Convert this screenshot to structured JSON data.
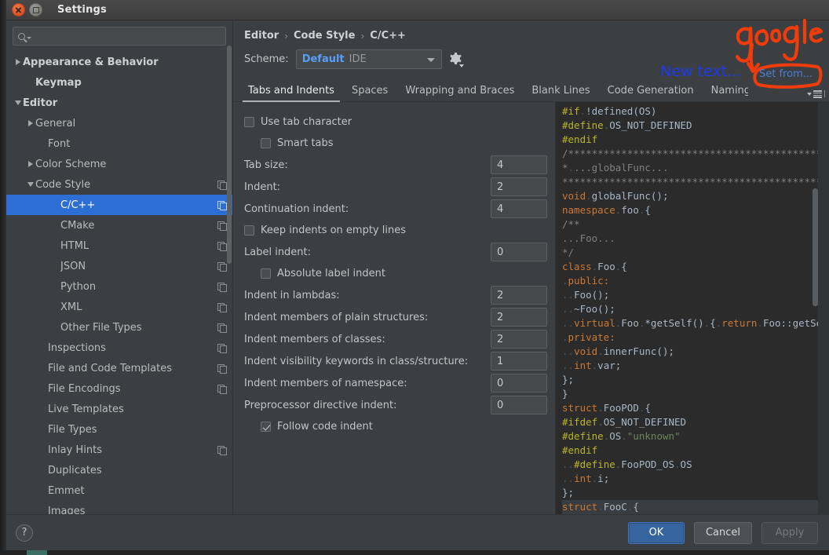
{
  "window": {
    "title": "Settings",
    "close_icon": "close-icon",
    "maximize_icon": "maximize-icon"
  },
  "sidebar": {
    "search": {
      "placeholder": "",
      "value": "",
      "icon": "search-icon"
    },
    "items": [
      {
        "label": "Appearance & Behavior",
        "indent": 0,
        "twisty": "right",
        "bold": true,
        "copy": false,
        "selected": false
      },
      {
        "label": "Keymap",
        "indent": 1,
        "twisty": "none",
        "bold": true,
        "copy": false,
        "selected": false
      },
      {
        "label": "Editor",
        "indent": 0,
        "twisty": "down",
        "bold": true,
        "copy": false,
        "selected": false
      },
      {
        "label": "General",
        "indent": 1,
        "twisty": "right",
        "bold": false,
        "copy": false,
        "selected": false
      },
      {
        "label": "Font",
        "indent": 2,
        "twisty": "none",
        "bold": false,
        "copy": false,
        "selected": false
      },
      {
        "label": "Color Scheme",
        "indent": 1,
        "twisty": "right",
        "bold": false,
        "copy": false,
        "selected": false
      },
      {
        "label": "Code Style",
        "indent": 1,
        "twisty": "down",
        "bold": false,
        "copy": true,
        "selected": false
      },
      {
        "label": "C/C++",
        "indent": 3,
        "twisty": "none",
        "bold": false,
        "copy": true,
        "selected": true
      },
      {
        "label": "CMake",
        "indent": 3,
        "twisty": "none",
        "bold": false,
        "copy": true,
        "selected": false
      },
      {
        "label": "HTML",
        "indent": 3,
        "twisty": "none",
        "bold": false,
        "copy": true,
        "selected": false
      },
      {
        "label": "JSON",
        "indent": 3,
        "twisty": "none",
        "bold": false,
        "copy": true,
        "selected": false
      },
      {
        "label": "Python",
        "indent": 3,
        "twisty": "none",
        "bold": false,
        "copy": true,
        "selected": false
      },
      {
        "label": "XML",
        "indent": 3,
        "twisty": "none",
        "bold": false,
        "copy": true,
        "selected": false
      },
      {
        "label": "Other File Types",
        "indent": 3,
        "twisty": "none",
        "bold": false,
        "copy": true,
        "selected": false
      },
      {
        "label": "Inspections",
        "indent": 2,
        "twisty": "none",
        "bold": false,
        "copy": true,
        "selected": false
      },
      {
        "label": "File and Code Templates",
        "indent": 2,
        "twisty": "none",
        "bold": false,
        "copy": true,
        "selected": false
      },
      {
        "label": "File Encodings",
        "indent": 2,
        "twisty": "none",
        "bold": false,
        "copy": true,
        "selected": false
      },
      {
        "label": "Live Templates",
        "indent": 2,
        "twisty": "none",
        "bold": false,
        "copy": false,
        "selected": false
      },
      {
        "label": "File Types",
        "indent": 2,
        "twisty": "none",
        "bold": false,
        "copy": false,
        "selected": false
      },
      {
        "label": "Inlay Hints",
        "indent": 2,
        "twisty": "none",
        "bold": false,
        "copy": true,
        "selected": false
      },
      {
        "label": "Duplicates",
        "indent": 2,
        "twisty": "none",
        "bold": false,
        "copy": false,
        "selected": false
      },
      {
        "label": "Emmet",
        "indent": 2,
        "twisty": "none",
        "bold": false,
        "copy": false,
        "selected": false
      },
      {
        "label": "Images",
        "indent": 2,
        "twisty": "none",
        "bold": false,
        "copy": false,
        "selected": false
      }
    ]
  },
  "breadcrumb": {
    "parts": [
      "Editor",
      "Code Style",
      "C/C++"
    ],
    "separator": "›"
  },
  "scheme": {
    "label": "Scheme:",
    "name": "Default",
    "kind": "IDE",
    "gear_icon": "gear-icon",
    "caret_icon": "chevron-down-icon"
  },
  "tabs": {
    "items": [
      {
        "label": "Tabs and Indents",
        "active": true
      },
      {
        "label": "Spaces",
        "active": false
      },
      {
        "label": "Wrapping and Braces",
        "active": false
      },
      {
        "label": "Blank Lines",
        "active": false
      },
      {
        "label": "Code Generation",
        "active": false
      },
      {
        "label": "Naming",
        "active": false
      }
    ],
    "overflow_icon": "tab-overflow-icon"
  },
  "form": {
    "rows": [
      {
        "type": "checkbox",
        "label": "Use tab character",
        "checked": false,
        "indent": 0
      },
      {
        "type": "checkbox",
        "label": "Smart tabs",
        "checked": false,
        "indent": 1
      },
      {
        "type": "field",
        "label": "Tab size:",
        "value": "4"
      },
      {
        "type": "field",
        "label": "Indent:",
        "value": "2"
      },
      {
        "type": "field",
        "label": "Continuation indent:",
        "value": "4"
      },
      {
        "type": "checkbox",
        "label": "Keep indents on empty lines",
        "checked": false,
        "indent": 0
      },
      {
        "type": "field",
        "label": "Label indent:",
        "value": "0"
      },
      {
        "type": "checkbox",
        "label": "Absolute label indent",
        "checked": false,
        "indent": 1
      },
      {
        "type": "field",
        "label": "Indent in lambdas:",
        "value": "2"
      },
      {
        "type": "field",
        "label": "Indent members of plain structures:",
        "value": "2"
      },
      {
        "type": "field",
        "label": "Indent members of classes:",
        "value": "2"
      },
      {
        "type": "field",
        "label": "Indent visibility keywords in class/structure:",
        "value": "1"
      },
      {
        "type": "field",
        "label": "Indent members of namespace:",
        "value": "0"
      },
      {
        "type": "field",
        "label": "Preprocessor directive indent:",
        "value": "0"
      },
      {
        "type": "checkbox",
        "label": "Follow code indent",
        "checked": true,
        "indent": 1
      }
    ]
  },
  "preview": {
    "lines": [
      [
        [
          "pre",
          "#if"
        ],
        [
          "dot",
          "."
        ],
        [
          "pln",
          "!defined(OS)"
        ]
      ],
      [
        [
          "pre",
          "#define"
        ],
        [
          "dot",
          "."
        ],
        [
          "pln",
          "OS_NOT_DEFINED"
        ]
      ],
      [
        [
          "pre",
          "#endif"
        ]
      ],
      [
        [
          "cmt",
          "/***********************************************"
        ]
      ],
      [
        [
          "cmt",
          "*"
        ],
        [
          "dot",
          "."
        ],
        [
          "cmt",
          "...globalFunc..."
        ]
      ],
      [
        [
          "cmt",
          "***********************************************/"
        ]
      ],
      [
        [
          "kw",
          "void"
        ],
        [
          "dot",
          "."
        ],
        [
          "pln",
          "globalFunc();"
        ]
      ],
      [
        [
          "kw",
          "namespace"
        ],
        [
          "dot",
          "."
        ],
        [
          "pln",
          "foo"
        ],
        [
          "dot",
          "."
        ],
        [
          "pln",
          "{"
        ]
      ],
      [
        [
          "cmt",
          "/**"
        ]
      ],
      [
        [
          "cmt",
          "...Foo..."
        ]
      ],
      [
        [
          "cmt",
          "*/"
        ]
      ],
      [
        [
          "kw",
          "class"
        ],
        [
          "dot",
          "."
        ],
        [
          "pln",
          "Foo"
        ],
        [
          "dot",
          "."
        ],
        [
          "pln",
          "{"
        ]
      ],
      [
        [
          "dot",
          "."
        ],
        [
          "kw",
          "public:"
        ]
      ],
      [
        [
          "dot",
          ".."
        ],
        [
          "pln",
          "Foo();"
        ]
      ],
      [
        [
          "dot",
          ".."
        ],
        [
          "pln",
          "~Foo();"
        ]
      ],
      [
        [
          "dot",
          ".."
        ],
        [
          "kw",
          "virtual"
        ],
        [
          "dot",
          "."
        ],
        [
          "pln",
          "Foo"
        ],
        [
          "dot",
          "."
        ],
        [
          "pln",
          "*getSelf()"
        ],
        [
          "dot",
          "."
        ],
        [
          "pln",
          "{"
        ],
        [
          "dot",
          "."
        ],
        [
          "kw",
          "return"
        ],
        [
          "dot",
          "."
        ],
        [
          "pln",
          "Foo::getSelf()"
        ]
      ],
      [
        [
          "dot",
          "."
        ],
        [
          "kw",
          "private:"
        ]
      ],
      [
        [
          "dot",
          ".."
        ],
        [
          "kw",
          "void"
        ],
        [
          "dot",
          "."
        ],
        [
          "pln",
          "innerFunc();"
        ]
      ],
      [
        [
          "dot",
          ".."
        ],
        [
          "kw",
          "int"
        ],
        [
          "dot",
          "."
        ],
        [
          "pln",
          "var;"
        ]
      ],
      [
        [
          "pln",
          "};"
        ]
      ],
      [
        [
          "pln",
          "}"
        ]
      ],
      [
        [
          "kw",
          "struct"
        ],
        [
          "dot",
          "."
        ],
        [
          "pln",
          "FooPOD"
        ],
        [
          "dot",
          "."
        ],
        [
          "pln",
          "{"
        ]
      ],
      [
        [
          "pre",
          "#ifdef"
        ],
        [
          "dot",
          "."
        ],
        [
          "pln",
          "OS_NOT_DEFINED"
        ]
      ],
      [
        [
          "pre",
          "#define"
        ],
        [
          "dot",
          "."
        ],
        [
          "pln",
          "OS"
        ],
        [
          "dot",
          "."
        ],
        [
          "str",
          "\"unknown\""
        ]
      ],
      [
        [
          "pre",
          "#endif"
        ]
      ],
      [
        [
          "dot",
          ".."
        ],
        [
          "pre",
          "#define"
        ],
        [
          "dot",
          "."
        ],
        [
          "pln",
          "FooPOD_OS"
        ],
        [
          "dot",
          "."
        ],
        [
          "pln",
          "OS"
        ]
      ],
      [
        [
          "dot",
          ".."
        ],
        [
          "kw",
          "int"
        ],
        [
          "dot",
          "."
        ],
        [
          "pln",
          "i;"
        ]
      ],
      [
        [
          "pln",
          "};"
        ]
      ],
      [
        [
          "kw",
          "struct"
        ],
        [
          "dot",
          "."
        ],
        [
          "pln",
          "FooC"
        ],
        [
          "dot",
          "."
        ],
        [
          "pln",
          "{"
        ]
      ]
    ],
    "highlight_line_index": 28
  },
  "footer": {
    "help_label": "?",
    "ok_label": "OK",
    "cancel_label": "Cancel",
    "apply_label": "Apply"
  },
  "annotations": {
    "handwritten_google": "google",
    "new_text_label": "New text...",
    "set_from_label": "Set from...",
    "ink_color": "#f03c0a",
    "new_text_color": "#1d39f0",
    "set_from_color": "#4a7fd4"
  },
  "colors": {
    "accent_selection": "#2d6ed4",
    "scheme_name": "#589df6",
    "window_bg": "#3c3f41",
    "editor_bg": "#2b2b2b",
    "ok_button": "#35649f"
  }
}
